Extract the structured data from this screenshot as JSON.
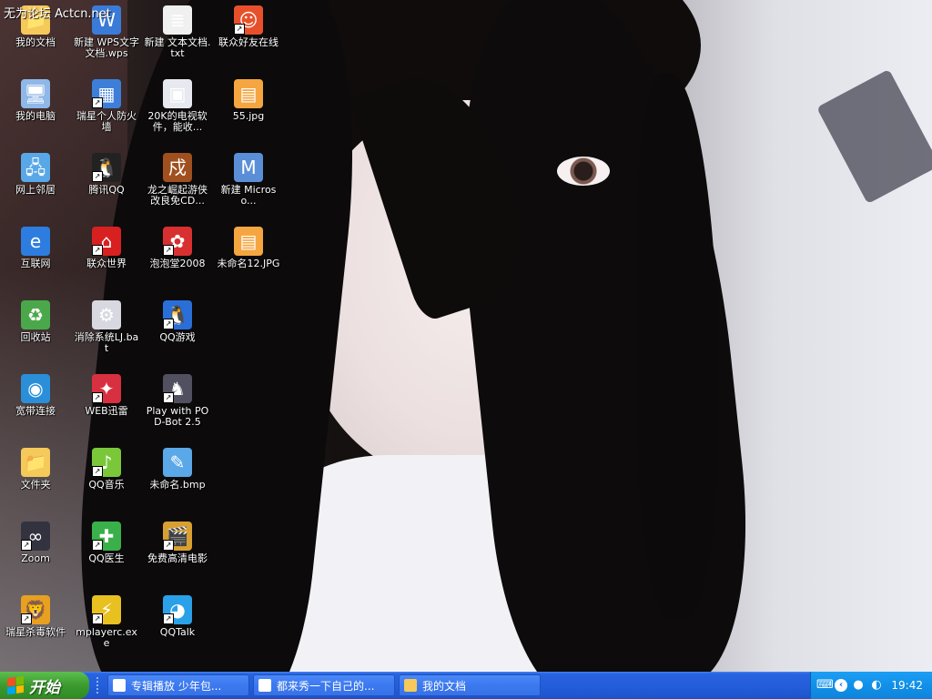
{
  "watermark": "无为论坛 Actcn.net",
  "desktop": {
    "icons": [
      {
        "label": "我的文档",
        "glyph": "📁",
        "color": "#f5c95a",
        "shortcut": false
      },
      {
        "label": "新建 WPS文字文档.wps",
        "glyph": "W",
        "color": "#3b7bd8",
        "shortcut": false
      },
      {
        "label": "新建 文本文档.txt",
        "glyph": "≣",
        "color": "#f0f0f0",
        "shortcut": false
      },
      {
        "label": "联众好友在线",
        "glyph": "☺",
        "color": "#e8502b",
        "shortcut": true
      },
      {
        "label": "我的电脑",
        "glyph": "🖥",
        "color": "#8fb8e8",
        "shortcut": false
      },
      {
        "label": "瑞星个人防火墙",
        "glyph": "▦",
        "color": "#3d7fd8",
        "shortcut": true
      },
      {
        "label": "20K的电视软件，能收...",
        "glyph": "▣",
        "color": "#e8e8f0",
        "shortcut": false
      },
      {
        "label": "55.jpg",
        "glyph": "▤",
        "color": "#f5a640",
        "shortcut": false
      },
      {
        "label": "网上邻居",
        "glyph": "🖧",
        "color": "#58a8e8",
        "shortcut": false
      },
      {
        "label": "腾讯QQ",
        "glyph": "🐧",
        "color": "#222222",
        "shortcut": true
      },
      {
        "label": "龙之崛起游侠改良免CD...",
        "glyph": "戍",
        "color": "#a0501e",
        "shortcut": false
      },
      {
        "label": "新建 Microso...",
        "glyph": "M",
        "color": "#5a8fd8",
        "shortcut": false
      },
      {
        "label": "互联网",
        "glyph": "e",
        "color": "#2d7de0",
        "shortcut": false
      },
      {
        "label": "联众世界",
        "glyph": "⌂",
        "color": "#d82020",
        "shortcut": true
      },
      {
        "label": "泡泡堂2008",
        "glyph": "✿",
        "color": "#d83030",
        "shortcut": true
      },
      {
        "label": "未命名12.JPG",
        "glyph": "▤",
        "color": "#f5a640",
        "shortcut": false
      },
      {
        "label": "回收站",
        "glyph": "♻",
        "color": "#4aa84a",
        "shortcut": false
      },
      {
        "label": "消除系统LJ.bat",
        "glyph": "⚙",
        "color": "#d8d8e0",
        "shortcut": false
      },
      {
        "label": "QQ游戏",
        "glyph": "🐧",
        "color": "#2a6fd8",
        "shortcut": true
      },
      {
        "label": "宽带连接",
        "glyph": "◉",
        "color": "#2a8fd8",
        "shortcut": false
      },
      {
        "label": "WEB迅雷",
        "glyph": "✦",
        "color": "#d83040",
        "shortcut": true
      },
      {
        "label": "Play with POD-Bot 2.5",
        "glyph": "♞",
        "color": "#505060",
        "shortcut": true
      },
      {
        "label": "文件夹",
        "glyph": "📁",
        "color": "#f5c95a",
        "shortcut": false
      },
      {
        "label": "QQ音乐",
        "glyph": "♪",
        "color": "#7ac83a",
        "shortcut": true
      },
      {
        "label": "未命名.bmp",
        "glyph": "✎",
        "color": "#5aa8e8",
        "shortcut": false
      },
      {
        "label": "Zoom",
        "glyph": "∞",
        "color": "#333340",
        "shortcut": true
      },
      {
        "label": "QQ医生",
        "glyph": "✚",
        "color": "#3ab04a",
        "shortcut": true
      },
      {
        "label": "免费高清电影",
        "glyph": "🎬",
        "color": "#d8a030",
        "shortcut": true
      },
      {
        "label": "瑞星杀毒软件",
        "glyph": "🦁",
        "color": "#e8a020",
        "shortcut": true
      },
      {
        "label": "mplayerc.exe",
        "glyph": "⚡",
        "color": "#e8c020",
        "shortcut": true
      },
      {
        "label": "QQTalk",
        "glyph": "◕",
        "color": "#2aa0e8",
        "shortcut": true
      }
    ]
  },
  "taskbar": {
    "start_label": "开始",
    "tasks": [
      {
        "label": "专辑播放 少年包..."
      },
      {
        "label": "都来秀一下自己的..."
      },
      {
        "label": "我的文档"
      }
    ],
    "tray_icons": [
      "keyboard-icon",
      "qq-icon",
      "speaker-icon"
    ],
    "clock": "19:42"
  }
}
